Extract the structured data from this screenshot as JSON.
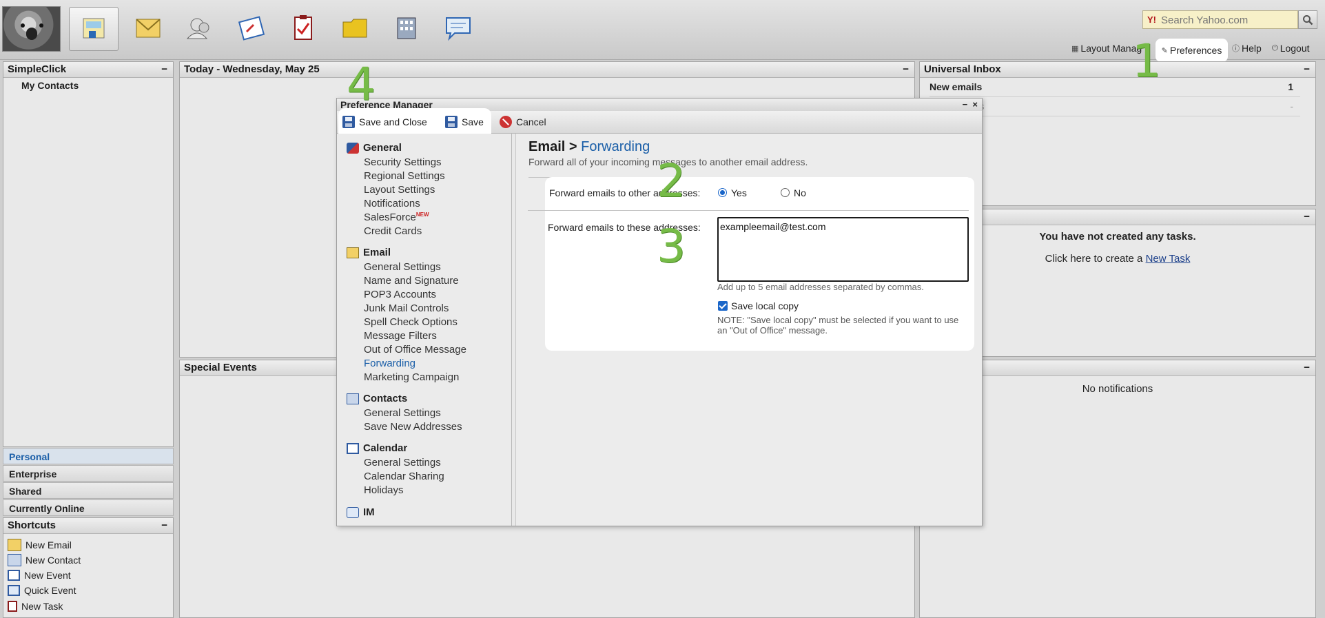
{
  "search": {
    "placeholder": "Search Yahoo.com"
  },
  "toplinks": {
    "layout": "Layout Manag",
    "preferences": "Preferences",
    "help": "Help",
    "logout": "Logout"
  },
  "apps": [
    "home",
    "email",
    "contacts",
    "calendar",
    "tasks",
    "files",
    "enterprise",
    "im"
  ],
  "left": {
    "title": "SimpleClick",
    "my_contacts": "My Contacts",
    "groups": [
      "Personal",
      "Enterprise",
      "Shared",
      "Currently Online"
    ]
  },
  "shortcuts": {
    "title": "Shortcuts",
    "items": [
      "New Email",
      "New Contact",
      "New Event",
      "Quick Event",
      "New Task"
    ]
  },
  "today": {
    "title": "Today - Wednesday, May 25"
  },
  "special": {
    "title": "Special Events"
  },
  "inbox": {
    "title": "Universal Inbox",
    "rows": [
      {
        "label": "New emails",
        "count": "1"
      },
      {
        "label": "uests",
        "count": "-"
      }
    ]
  },
  "tasks": {
    "empty": "You have not created any tasks.",
    "create_prefix": "Click here to create a ",
    "create_link": "New Task"
  },
  "notifications": {
    "title_fragment": "s",
    "empty": "No notifications"
  },
  "pm": {
    "title": "Preference Manager",
    "toolbar": {
      "save_close": "Save and Close",
      "save": "Save",
      "cancel": "Cancel"
    },
    "nav": {
      "general": {
        "label": "General",
        "items": [
          "Security Settings",
          "Regional Settings",
          "Layout Settings",
          "Notifications",
          "SalesForce",
          "Credit Cards"
        ],
        "new_badge": "NEW"
      },
      "email": {
        "label": "Email",
        "items": [
          "General Settings",
          "Name and Signature",
          "POP3 Accounts",
          "Junk Mail Controls",
          "Spell Check Options",
          "Message Filters",
          "Out of Office Message",
          "Forwarding",
          "Marketing Campaign"
        ]
      },
      "contacts": {
        "label": "Contacts",
        "items": [
          "General Settings",
          "Save New Addresses"
        ]
      },
      "calendar": {
        "label": "Calendar",
        "items": [
          "General Settings",
          "Calendar Sharing",
          "Holidays"
        ]
      },
      "im": {
        "label": "IM"
      }
    },
    "content": {
      "crumb_main": "Email > ",
      "crumb_sub": "Forwarding",
      "desc": "Forward all of your incoming messages to another email address.",
      "forward_label": "Forward emails to other addresses:",
      "yes": "Yes",
      "no": "No",
      "addresses_label": "Forward emails to these addresses:",
      "addresses_value": "exampleemail@test.com",
      "hint": "Add up to 5 email addresses separated by commas.",
      "save_local": "Save local copy",
      "note": "NOTE: \"Save local copy\" must be selected if you want to use an \"Out of Office\" message."
    }
  },
  "steps": [
    "1",
    "2",
    "3",
    "4"
  ],
  "colors": {
    "accent": "#1b5fa8",
    "step_green": "#76bb47"
  }
}
